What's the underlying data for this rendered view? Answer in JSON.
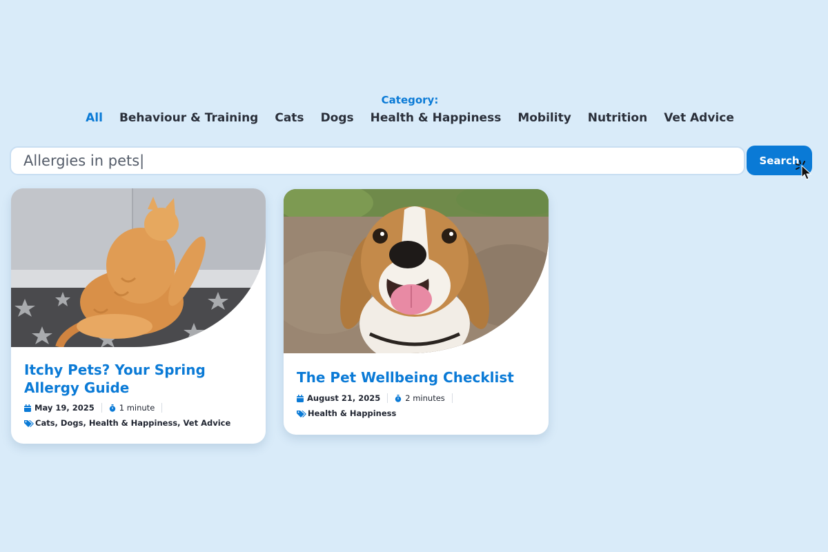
{
  "filter": {
    "label": "Category:",
    "categories": [
      "All",
      "Behaviour & Training",
      "Cats",
      "Dogs",
      "Health & Happiness",
      "Mobility",
      "Nutrition",
      "Vet Advice"
    ],
    "active": "All"
  },
  "search": {
    "value": "Allergies in pets|",
    "button_label": "Search"
  },
  "cards": [
    {
      "title": "Itchy Pets? Your Spring Allergy Guide",
      "date": "May 19, 2025",
      "read_time": "1 minute",
      "tags": [
        "Cats",
        "Dogs",
        "Health & Happiness",
        "Vet Advice"
      ]
    },
    {
      "title": "The Pet Wellbeing Checklist",
      "date": "August 21, 2025",
      "read_time": "2 minutes",
      "tags": [
        "Health & Happiness"
      ]
    }
  ],
  "colors": {
    "background": "#d9ebf9",
    "accent": "#0a7ad6",
    "text": "#1f2430"
  },
  "icons": [
    "calendar-icon",
    "timer-icon",
    "tag-icon",
    "cursor-click-icon"
  ]
}
